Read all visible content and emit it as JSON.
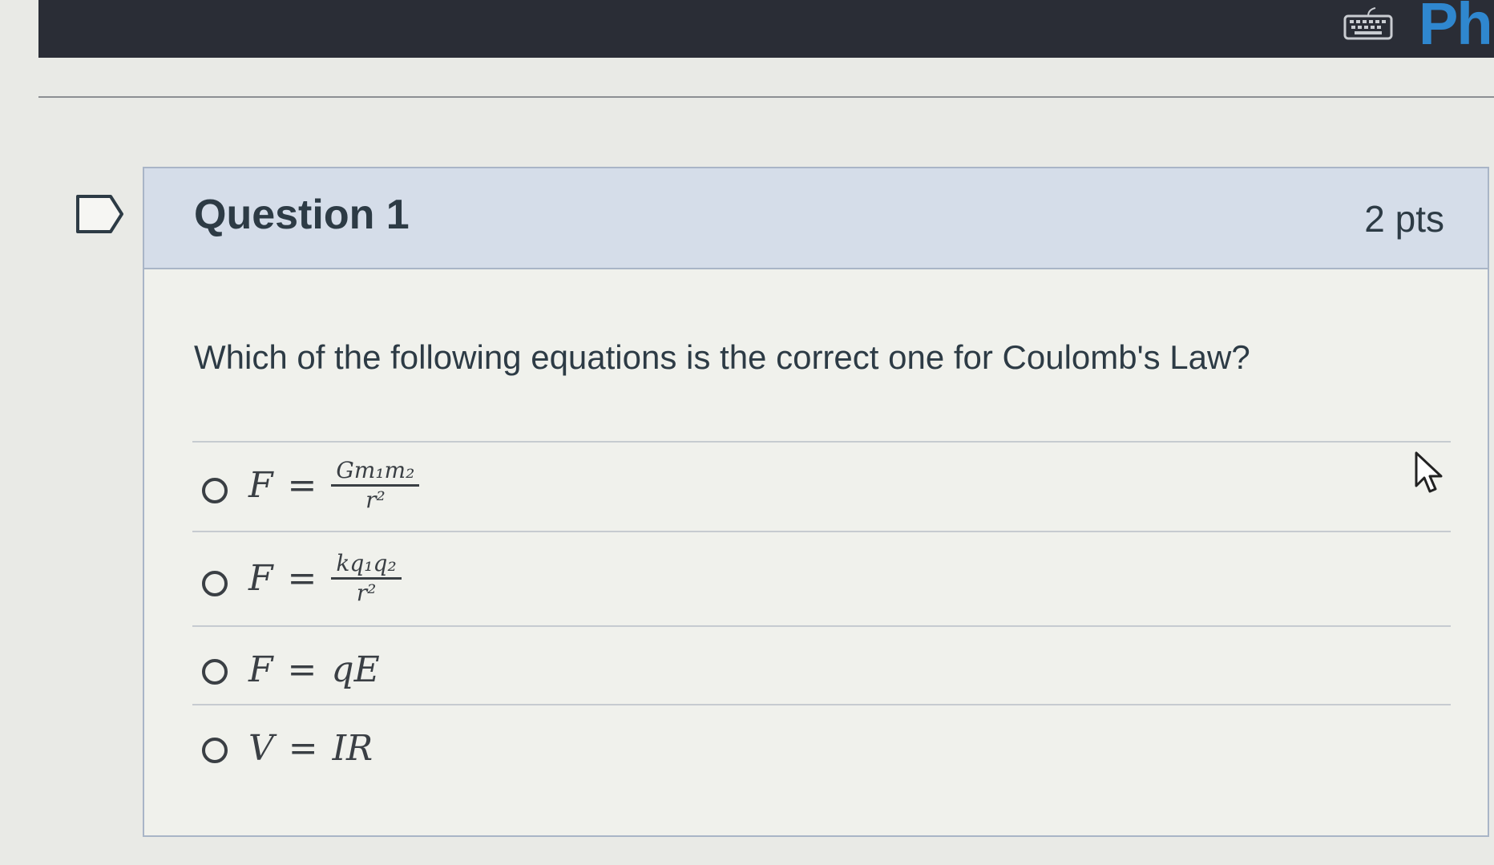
{
  "app": {
    "brand": "PhE"
  },
  "question": {
    "title": "Question 1",
    "points": "2 pts",
    "prompt": "Which of the following equations is the correct one for Coulomb's Law?"
  },
  "answers": [
    {
      "lhs": "F",
      "eq": "=",
      "numerator": "Gm₁m₂",
      "denominator": "r²"
    },
    {
      "lhs": "F",
      "eq": "=",
      "numerator": "kq₁q₂",
      "denominator": "r²"
    },
    {
      "lhs": "F",
      "eq": "=",
      "rhs": "qE"
    },
    {
      "lhs": "V",
      "eq": "=",
      "rhs": "IR"
    }
  ],
  "icons": {
    "keyboard": "keyboard-icon",
    "flag": "flag-icon",
    "cursor": "mouse-cursor-icon",
    "radio": "radio-button"
  },
  "colors": {
    "topbar": "#2a2d36",
    "brand": "#2f87cf",
    "header": "#d5dde9",
    "text": "#2d3b45"
  }
}
